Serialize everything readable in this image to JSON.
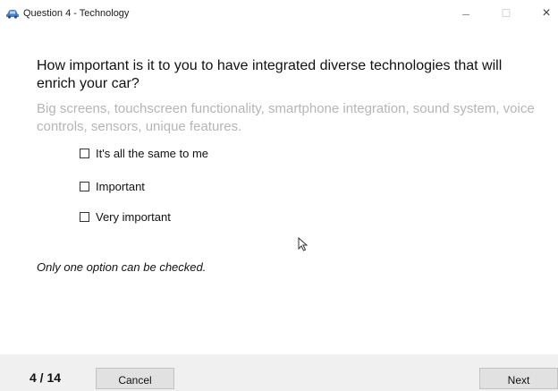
{
  "window": {
    "title": "Question 4 - Technology",
    "controls": {
      "minimize": "–",
      "maximize": "☐",
      "close": "×"
    }
  },
  "question": {
    "text": "How important is it to you to have integrated diverse technologies that will enrich your car?",
    "description": "Big screens, touchscreen functionality, smartphone integration, sound system, voice controls, sensors, unique features."
  },
  "options": [
    {
      "label": "It's all the same to me",
      "checked": false
    },
    {
      "label": "Important",
      "checked": false
    },
    {
      "label": "Very important",
      "checked": false
    }
  ],
  "hint": "Only one option can be checked.",
  "footer": {
    "counter": "4 / 14",
    "cancel_label": "Cancel",
    "next_label": "Next"
  },
  "icons": {
    "app": "car-icon",
    "cursor": "mouse-cursor-icon"
  },
  "colors": {
    "description": "#b5b5b5",
    "button_bg": "#e1e1e1",
    "app_icon": "#4a7fc1"
  }
}
